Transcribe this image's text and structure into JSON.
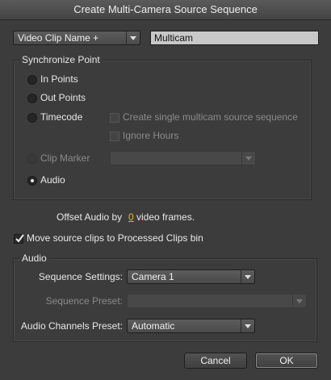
{
  "window": {
    "title": "Create Multi-Camera Source Sequence"
  },
  "name_source": {
    "selected": "Video Clip Name +",
    "value": "Multicam"
  },
  "sync": {
    "group_label": "Synchronize Point",
    "in_points": "In Points",
    "out_points": "Out Points",
    "timecode": "Timecode",
    "single_multicam": "Create single multicam source sequence",
    "ignore_hours": "Ignore Hours",
    "clip_marker": "Clip Marker",
    "clip_marker_value": "",
    "audio": "Audio",
    "selected": "audio"
  },
  "offset": {
    "prefix": "Offset Audio by",
    "value": "0",
    "suffix": "video frames."
  },
  "move_clips": {
    "label": "Move source clips to Processed Clips bin",
    "checked": true
  },
  "audio": {
    "group_label": "Audio",
    "sequence_settings_label": "Sequence Settings:",
    "sequence_settings_value": "Camera 1",
    "sequence_preset_label": "Sequence Preset:",
    "sequence_preset_value": "",
    "channels_preset_label": "Audio Channels Preset:",
    "channels_preset_value": "Automatic"
  },
  "buttons": {
    "cancel": "Cancel",
    "ok": "OK"
  },
  "icons": {
    "caret": "chevron-down-icon",
    "check": "checkmark-icon"
  }
}
